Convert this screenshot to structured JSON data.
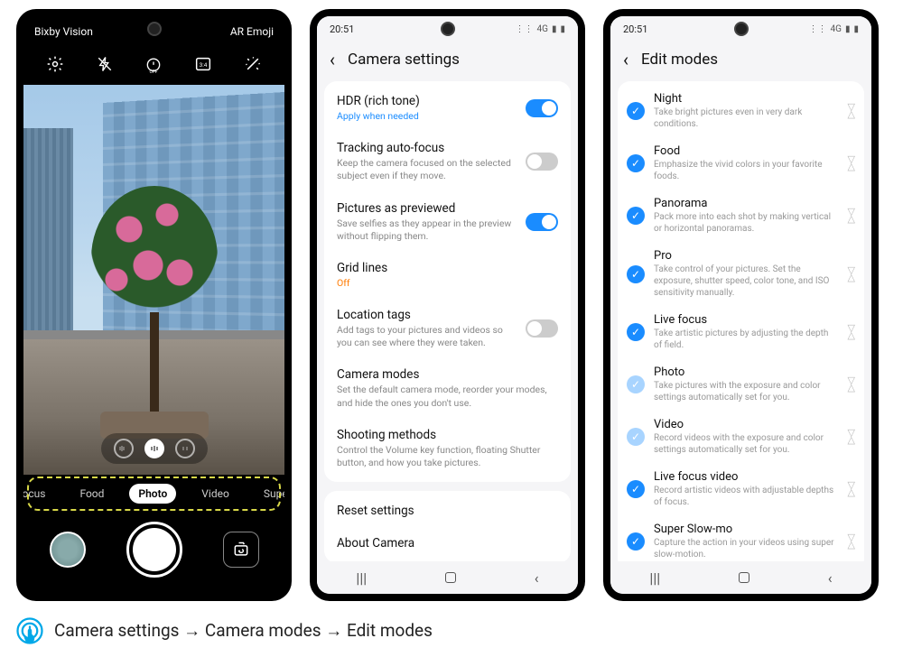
{
  "phone1": {
    "top_left": "Bixby Vision",
    "top_right": "AR Emoji",
    "icons": {
      "settings": "gear",
      "flash": "flash-off",
      "timer": "timer-off",
      "ratio": "3:4",
      "filters": "wand"
    },
    "modes": {
      "items": [
        "ve focus",
        "Food",
        "Photo",
        "Video",
        "Super Sl"
      ],
      "active_index": 2
    },
    "shutter": {
      "thumb": "last-shot",
      "switch": "switch-camera"
    }
  },
  "phone2": {
    "time": "20:51",
    "title": "Camera settings",
    "rows": [
      {
        "title": "HDR (rich tone)",
        "sub": "Apply when needed",
        "sub_style": "blue",
        "toggle": true
      },
      {
        "title": "Tracking auto-focus",
        "sub": "Keep the camera focused on the selected subject even if they move.",
        "toggle": false
      },
      {
        "title": "Pictures as previewed",
        "sub": "Save selfies as they appear in the preview without flipping them.",
        "toggle": true
      },
      {
        "title": "Grid lines",
        "sub": "Off",
        "sub_style": "orange"
      },
      {
        "title": "Location tags",
        "sub": "Add tags to your pictures and videos so you can see where they were taken.",
        "toggle": false
      },
      {
        "title": "Camera modes",
        "sub": "Set the default camera mode, reorder your modes, and hide the ones you don't use."
      },
      {
        "title": "Shooting methods",
        "sub": "Control the Volume key function, floating Shutter button, and how you take pictures."
      }
    ],
    "rows2": [
      {
        "title": "Reset settings"
      },
      {
        "title": "About Camera"
      }
    ]
  },
  "phone3": {
    "time": "20:51",
    "title": "Edit modes",
    "modes": [
      {
        "name": "Night",
        "desc": "Take bright pictures even in very dark conditions.",
        "locked": false
      },
      {
        "name": "Food",
        "desc": "Emphasize the vivid colors in your favorite foods.",
        "locked": false
      },
      {
        "name": "Panorama",
        "desc": "Pack more into each shot by making vertical or horizontal panoramas.",
        "locked": false
      },
      {
        "name": "Pro",
        "desc": "Take control of your pictures. Set the exposure, shutter speed, color tone, and ISO sensitivity manually.",
        "locked": false
      },
      {
        "name": "Live focus",
        "desc": "Take artistic pictures by adjusting the depth of field.",
        "locked": false
      },
      {
        "name": "Photo",
        "desc": "Take pictures with the exposure and color settings automatically set for you.",
        "locked": true
      },
      {
        "name": "Video",
        "desc": "Record videos with the exposure and color settings automatically set for you.",
        "locked": true
      },
      {
        "name": "Live focus video",
        "desc": "Record artistic videos with adjustable depths of focus.",
        "locked": false
      },
      {
        "name": "Super Slow-mo",
        "desc": "Capture the action in your videos using super slow-motion.",
        "locked": false
      }
    ]
  },
  "footer": {
    "text": "Camera settings → Camera modes → Edit modes"
  }
}
